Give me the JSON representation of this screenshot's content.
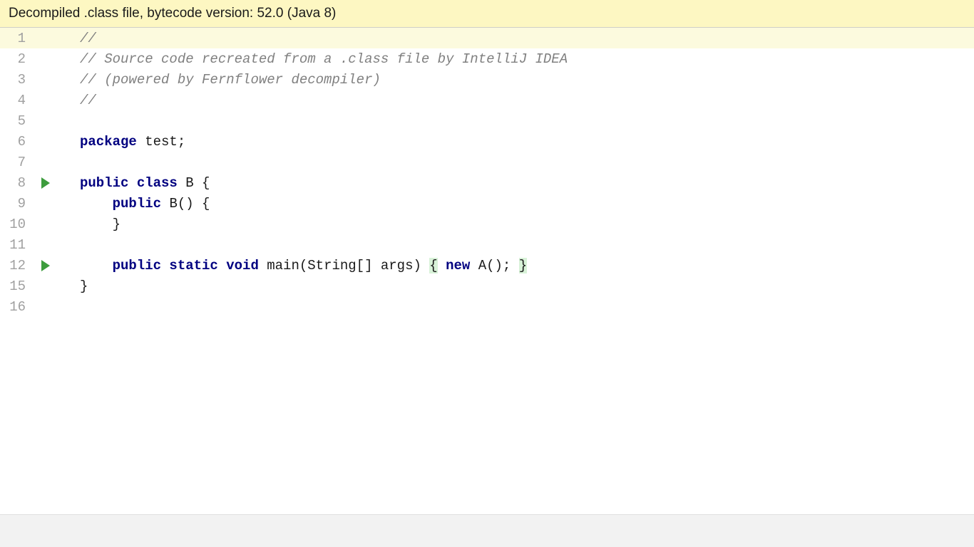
{
  "banner": {
    "text": "Decompiled .class file, bytecode version: 52.0 (Java 8)"
  },
  "lines": [
    {
      "num": "1",
      "run": false,
      "caret": true,
      "tokens": [
        {
          "cls": "comment",
          "t": "//"
        }
      ]
    },
    {
      "num": "2",
      "run": false,
      "caret": false,
      "tokens": [
        {
          "cls": "comment",
          "t": "// Source code recreated from a .class file by IntelliJ IDEA"
        }
      ]
    },
    {
      "num": "3",
      "run": false,
      "caret": false,
      "tokens": [
        {
          "cls": "comment",
          "t": "// (powered by Fernflower decompiler)"
        }
      ]
    },
    {
      "num": "4",
      "run": false,
      "caret": false,
      "tokens": [
        {
          "cls": "comment",
          "t": "//"
        }
      ]
    },
    {
      "num": "5",
      "run": false,
      "caret": false,
      "tokens": []
    },
    {
      "num": "6",
      "run": false,
      "caret": false,
      "tokens": [
        {
          "cls": "keyword",
          "t": "package "
        },
        {
          "cls": "plain",
          "t": "test;"
        }
      ]
    },
    {
      "num": "7",
      "run": false,
      "caret": false,
      "tokens": []
    },
    {
      "num": "8",
      "run": true,
      "caret": false,
      "tokens": [
        {
          "cls": "keyword",
          "t": "public class "
        },
        {
          "cls": "plain",
          "t": "B {"
        }
      ]
    },
    {
      "num": "9",
      "run": false,
      "caret": false,
      "tokens": [
        {
          "cls": "plain",
          "t": "    "
        },
        {
          "cls": "keyword",
          "t": "public "
        },
        {
          "cls": "plain",
          "t": "B() {"
        }
      ]
    },
    {
      "num": "10",
      "run": false,
      "caret": false,
      "tokens": [
        {
          "cls": "plain",
          "t": "    }"
        }
      ]
    },
    {
      "num": "11",
      "run": false,
      "caret": false,
      "tokens": []
    },
    {
      "num": "12",
      "run": true,
      "caret": false,
      "tokens": [
        {
          "cls": "plain",
          "t": "    "
        },
        {
          "cls": "keyword",
          "t": "public static void "
        },
        {
          "cls": "plain",
          "t": "main(String[] args) "
        },
        {
          "cls": "plain brace-highlight",
          "t": "{"
        },
        {
          "cls": "plain",
          "t": " "
        },
        {
          "cls": "keyword",
          "t": "new "
        },
        {
          "cls": "plain",
          "t": "A(); "
        },
        {
          "cls": "plain brace-highlight",
          "t": "}"
        }
      ]
    },
    {
      "num": "15",
      "run": false,
      "caret": false,
      "tokens": [
        {
          "cls": "plain",
          "t": "}"
        }
      ]
    },
    {
      "num": "16",
      "run": false,
      "caret": false,
      "tokens": []
    }
  ]
}
